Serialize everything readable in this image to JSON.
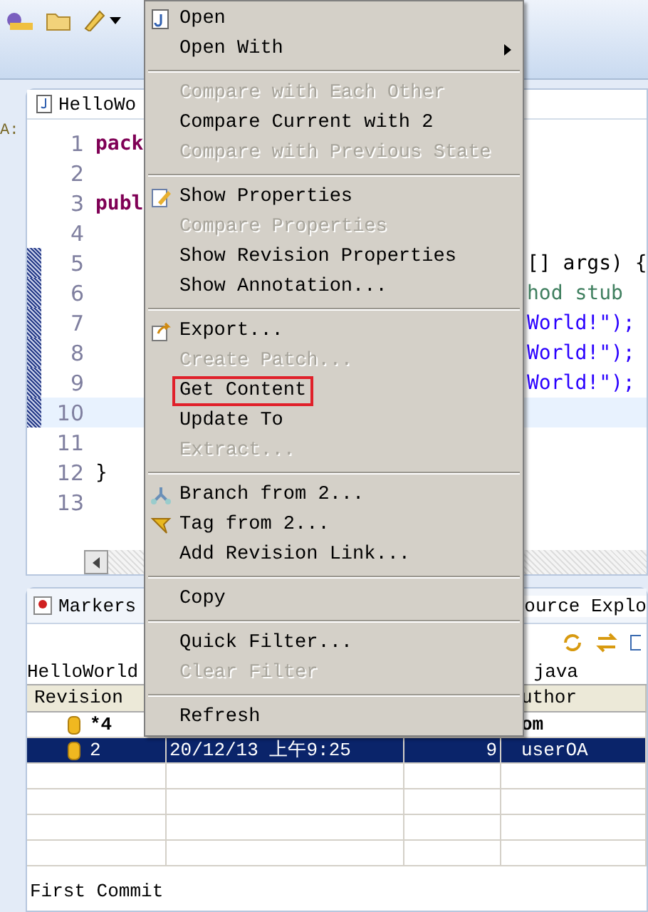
{
  "editor": {
    "tab_title": "HelloWo",
    "side_label": "A:",
    "lines": [
      {
        "number": "1",
        "left": "pack",
        "kind": "keyword",
        "marked": false
      },
      {
        "number": "2",
        "kind": "plain",
        "marked": false
      },
      {
        "number": "3",
        "left": "publ",
        "kind": "keyword",
        "marked": false
      },
      {
        "number": "4",
        "kind": "plain",
        "marked": false
      },
      {
        "number": "5",
        "right": "[] args) {",
        "kind": "plain",
        "marked": true
      },
      {
        "number": "6",
        "right": "hod stub",
        "kind": "comment",
        "marked": true
      },
      {
        "number": "7",
        "right": "World!\");",
        "kind": "string",
        "marked": true
      },
      {
        "number": "8",
        "right": "World!\");",
        "kind": "string",
        "marked": true
      },
      {
        "number": "9",
        "right": "World!\");",
        "kind": "string",
        "marked": true
      },
      {
        "number": "10",
        "kind": "plain",
        "marked": true
      },
      {
        "number": "11",
        "kind": "plain",
        "marked": false
      },
      {
        "number": "12",
        "left": "}",
        "kind": "plain",
        "marked": false
      },
      {
        "number": "13",
        "kind": "plain",
        "marked": false
      }
    ]
  },
  "bottom_panel": {
    "tabs": [
      {
        "label": "Markers",
        "selected": false
      },
      {
        "label": "ource Explo",
        "selected": true
      }
    ],
    "path_left": "HelloWorld",
    "path_right": "java",
    "columns": [
      "Revision",
      null,
      null,
      "uthor"
    ],
    "rows": [
      {
        "cells": [
          "*4",
          null,
          null,
          "om"
        ],
        "current": true,
        "selected": false
      },
      {
        "cells": [
          "2",
          "20/12/13 上午9:25",
          "9",
          "userOA"
        ],
        "current": false,
        "selected": true
      }
    ],
    "comment": "First Commit"
  },
  "context_menu": [
    {
      "kind": "item",
      "label": "Open",
      "disabled": false,
      "submenu": false,
      "outlined": false
    },
    {
      "kind": "item",
      "label": "Open With",
      "disabled": false,
      "submenu": true,
      "outlined": false
    },
    {
      "kind": "separator"
    },
    {
      "kind": "item",
      "label": "Compare with Each Other",
      "disabled": true,
      "submenu": false,
      "outlined": false
    },
    {
      "kind": "item",
      "label": "Compare Current with 2",
      "disabled": false,
      "submenu": false,
      "outlined": false
    },
    {
      "kind": "item",
      "label": "Compare with Previous State",
      "disabled": true,
      "submenu": false,
      "outlined": false
    },
    {
      "kind": "separator"
    },
    {
      "kind": "item",
      "label": "Show Properties",
      "disabled": false,
      "submenu": false,
      "outlined": false
    },
    {
      "kind": "item",
      "label": "Compare Properties",
      "disabled": true,
      "submenu": false,
      "outlined": false
    },
    {
      "kind": "item",
      "label": "Show Revision Properties",
      "disabled": false,
      "submenu": false,
      "outlined": false
    },
    {
      "kind": "item",
      "label": "Show Annotation...",
      "disabled": false,
      "submenu": false,
      "outlined": false
    },
    {
      "kind": "separator"
    },
    {
      "kind": "item",
      "label": "Export...",
      "disabled": false,
      "submenu": false,
      "outlined": false
    },
    {
      "kind": "item",
      "label": "Create Patch...",
      "disabled": true,
      "submenu": false,
      "outlined": false
    },
    {
      "kind": "item",
      "label": "Get Content",
      "disabled": false,
      "submenu": false,
      "outlined": true
    },
    {
      "kind": "item",
      "label": "Update To",
      "disabled": false,
      "submenu": false,
      "outlined": false
    },
    {
      "kind": "item",
      "label": "Extract...",
      "disabled": true,
      "submenu": false,
      "outlined": false
    },
    {
      "kind": "separator"
    },
    {
      "kind": "item",
      "label": "Branch from 2...",
      "disabled": false,
      "submenu": false,
      "outlined": false
    },
    {
      "kind": "item",
      "label": "Tag from 2...",
      "disabled": false,
      "submenu": false,
      "outlined": false
    },
    {
      "kind": "item",
      "label": "Add Revision Link...",
      "disabled": false,
      "submenu": false,
      "outlined": false
    },
    {
      "kind": "separator"
    },
    {
      "kind": "item",
      "label": "Copy",
      "disabled": false,
      "submenu": false,
      "outlined": false
    },
    {
      "kind": "separator"
    },
    {
      "kind": "item",
      "label": "Quick Filter...",
      "disabled": false,
      "submenu": false,
      "outlined": false
    },
    {
      "kind": "item",
      "label": "Clear Filter",
      "disabled": true,
      "submenu": false,
      "outlined": false
    },
    {
      "kind": "separator"
    },
    {
      "kind": "item",
      "label": "Refresh",
      "disabled": false,
      "submenu": false,
      "outlined": false
    }
  ]
}
